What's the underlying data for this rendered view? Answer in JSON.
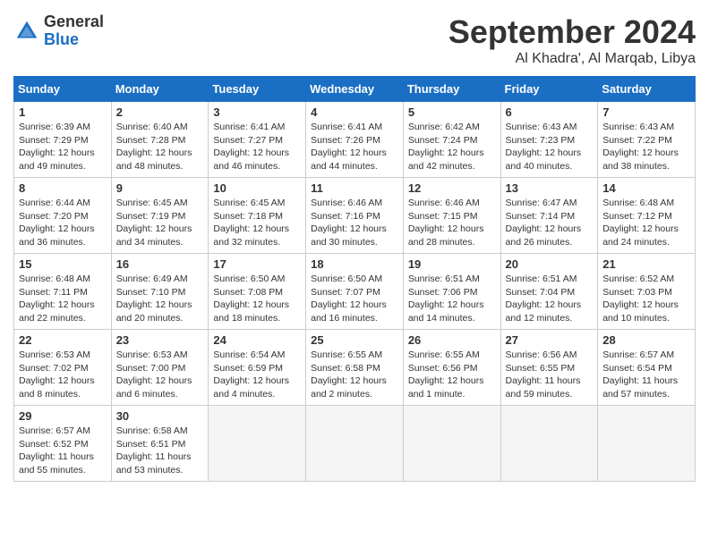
{
  "logo": {
    "general": "General",
    "blue": "Blue"
  },
  "title": "September 2024",
  "location": "Al Khadra', Al Marqab, Libya",
  "days_header": [
    "Sunday",
    "Monday",
    "Tuesday",
    "Wednesday",
    "Thursday",
    "Friday",
    "Saturday"
  ],
  "weeks": [
    [
      {
        "day": 1,
        "info": "Sunrise: 6:39 AM\nSunset: 7:29 PM\nDaylight: 12 hours\nand 49 minutes."
      },
      {
        "day": 2,
        "info": "Sunrise: 6:40 AM\nSunset: 7:28 PM\nDaylight: 12 hours\nand 48 minutes."
      },
      {
        "day": 3,
        "info": "Sunrise: 6:41 AM\nSunset: 7:27 PM\nDaylight: 12 hours\nand 46 minutes."
      },
      {
        "day": 4,
        "info": "Sunrise: 6:41 AM\nSunset: 7:26 PM\nDaylight: 12 hours\nand 44 minutes."
      },
      {
        "day": 5,
        "info": "Sunrise: 6:42 AM\nSunset: 7:24 PM\nDaylight: 12 hours\nand 42 minutes."
      },
      {
        "day": 6,
        "info": "Sunrise: 6:43 AM\nSunset: 7:23 PM\nDaylight: 12 hours\nand 40 minutes."
      },
      {
        "day": 7,
        "info": "Sunrise: 6:43 AM\nSunset: 7:22 PM\nDaylight: 12 hours\nand 38 minutes."
      }
    ],
    [
      {
        "day": 8,
        "info": "Sunrise: 6:44 AM\nSunset: 7:20 PM\nDaylight: 12 hours\nand 36 minutes."
      },
      {
        "day": 9,
        "info": "Sunrise: 6:45 AM\nSunset: 7:19 PM\nDaylight: 12 hours\nand 34 minutes."
      },
      {
        "day": 10,
        "info": "Sunrise: 6:45 AM\nSunset: 7:18 PM\nDaylight: 12 hours\nand 32 minutes."
      },
      {
        "day": 11,
        "info": "Sunrise: 6:46 AM\nSunset: 7:16 PM\nDaylight: 12 hours\nand 30 minutes."
      },
      {
        "day": 12,
        "info": "Sunrise: 6:46 AM\nSunset: 7:15 PM\nDaylight: 12 hours\nand 28 minutes."
      },
      {
        "day": 13,
        "info": "Sunrise: 6:47 AM\nSunset: 7:14 PM\nDaylight: 12 hours\nand 26 minutes."
      },
      {
        "day": 14,
        "info": "Sunrise: 6:48 AM\nSunset: 7:12 PM\nDaylight: 12 hours\nand 24 minutes."
      }
    ],
    [
      {
        "day": 15,
        "info": "Sunrise: 6:48 AM\nSunset: 7:11 PM\nDaylight: 12 hours\nand 22 minutes."
      },
      {
        "day": 16,
        "info": "Sunrise: 6:49 AM\nSunset: 7:10 PM\nDaylight: 12 hours\nand 20 minutes."
      },
      {
        "day": 17,
        "info": "Sunrise: 6:50 AM\nSunset: 7:08 PM\nDaylight: 12 hours\nand 18 minutes."
      },
      {
        "day": 18,
        "info": "Sunrise: 6:50 AM\nSunset: 7:07 PM\nDaylight: 12 hours\nand 16 minutes."
      },
      {
        "day": 19,
        "info": "Sunrise: 6:51 AM\nSunset: 7:06 PM\nDaylight: 12 hours\nand 14 minutes."
      },
      {
        "day": 20,
        "info": "Sunrise: 6:51 AM\nSunset: 7:04 PM\nDaylight: 12 hours\nand 12 minutes."
      },
      {
        "day": 21,
        "info": "Sunrise: 6:52 AM\nSunset: 7:03 PM\nDaylight: 12 hours\nand 10 minutes."
      }
    ],
    [
      {
        "day": 22,
        "info": "Sunrise: 6:53 AM\nSunset: 7:02 PM\nDaylight: 12 hours\nand 8 minutes."
      },
      {
        "day": 23,
        "info": "Sunrise: 6:53 AM\nSunset: 7:00 PM\nDaylight: 12 hours\nand 6 minutes."
      },
      {
        "day": 24,
        "info": "Sunrise: 6:54 AM\nSunset: 6:59 PM\nDaylight: 12 hours\nand 4 minutes."
      },
      {
        "day": 25,
        "info": "Sunrise: 6:55 AM\nSunset: 6:58 PM\nDaylight: 12 hours\nand 2 minutes."
      },
      {
        "day": 26,
        "info": "Sunrise: 6:55 AM\nSunset: 6:56 PM\nDaylight: 12 hours\nand 1 minute."
      },
      {
        "day": 27,
        "info": "Sunrise: 6:56 AM\nSunset: 6:55 PM\nDaylight: 11 hours\nand 59 minutes."
      },
      {
        "day": 28,
        "info": "Sunrise: 6:57 AM\nSunset: 6:54 PM\nDaylight: 11 hours\nand 57 minutes."
      }
    ],
    [
      {
        "day": 29,
        "info": "Sunrise: 6:57 AM\nSunset: 6:52 PM\nDaylight: 11 hours\nand 55 minutes."
      },
      {
        "day": 30,
        "info": "Sunrise: 6:58 AM\nSunset: 6:51 PM\nDaylight: 11 hours\nand 53 minutes."
      },
      null,
      null,
      null,
      null,
      null
    ]
  ]
}
